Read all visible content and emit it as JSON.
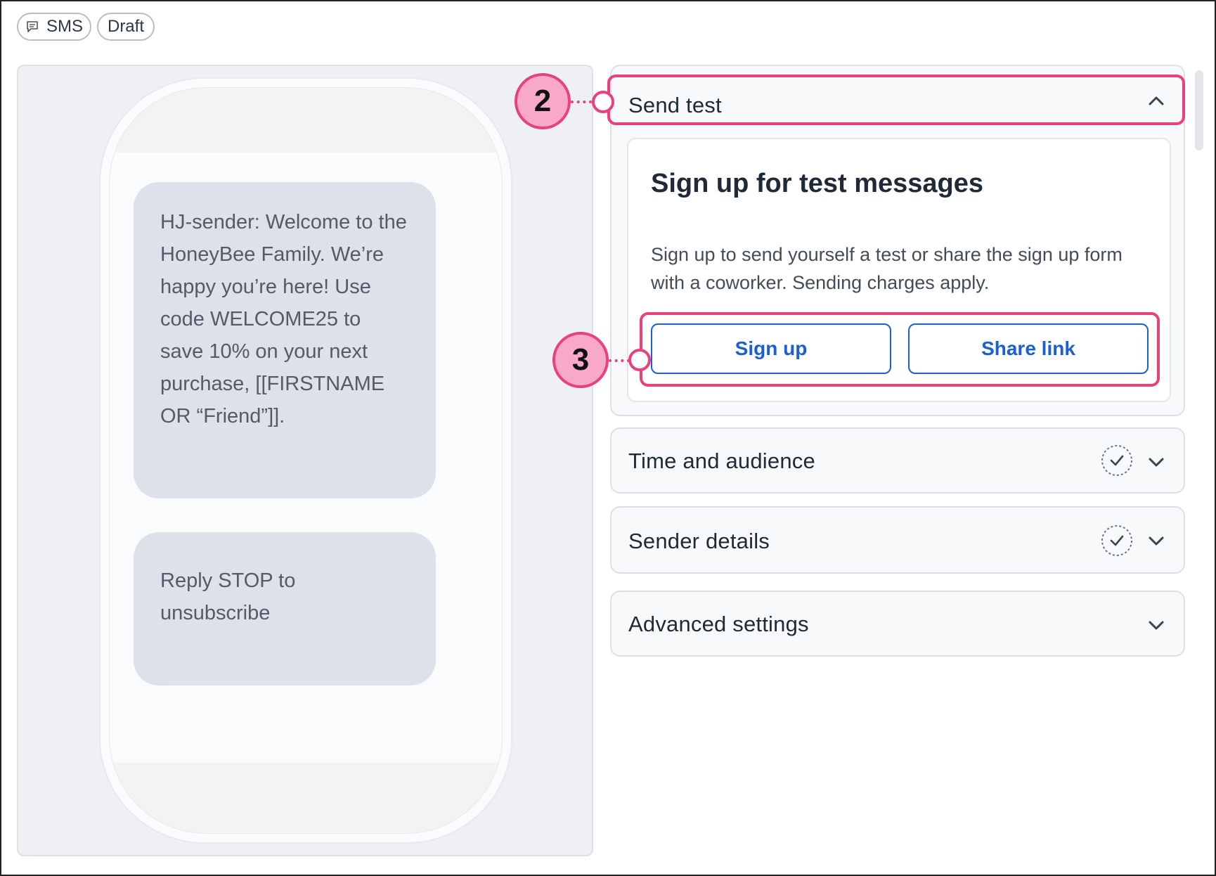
{
  "header": {
    "channel_chip": "SMS",
    "status_chip": "Draft"
  },
  "preview": {
    "messages": [
      "HJ-sender: Welcome to the HoneyBee Family. We’re happy you’re here! Use code WELCOME25 to save 10% on your next purchase, [[FIRSTNAME OR “Friend”]].",
      "Reply STOP to unsubscribe"
    ]
  },
  "send_test": {
    "title": "Send test",
    "card_title": "Sign up for test messages",
    "description": "Sign up to send yourself a test or share the sign up form with a coworker. Sending charges apply.",
    "signup_label": "Sign up",
    "share_label": "Share link"
  },
  "sections": {
    "time_audience": "Time and audience",
    "sender_details": "Sender details",
    "advanced_settings": "Advanced settings"
  },
  "annotations": {
    "step_2": "2",
    "step_3": "3"
  },
  "colors": {
    "accent": "#1b5fd3",
    "highlight": "#e8417d",
    "badge_fill": "#f9a9c8",
    "bubble": "#dde1ea"
  }
}
